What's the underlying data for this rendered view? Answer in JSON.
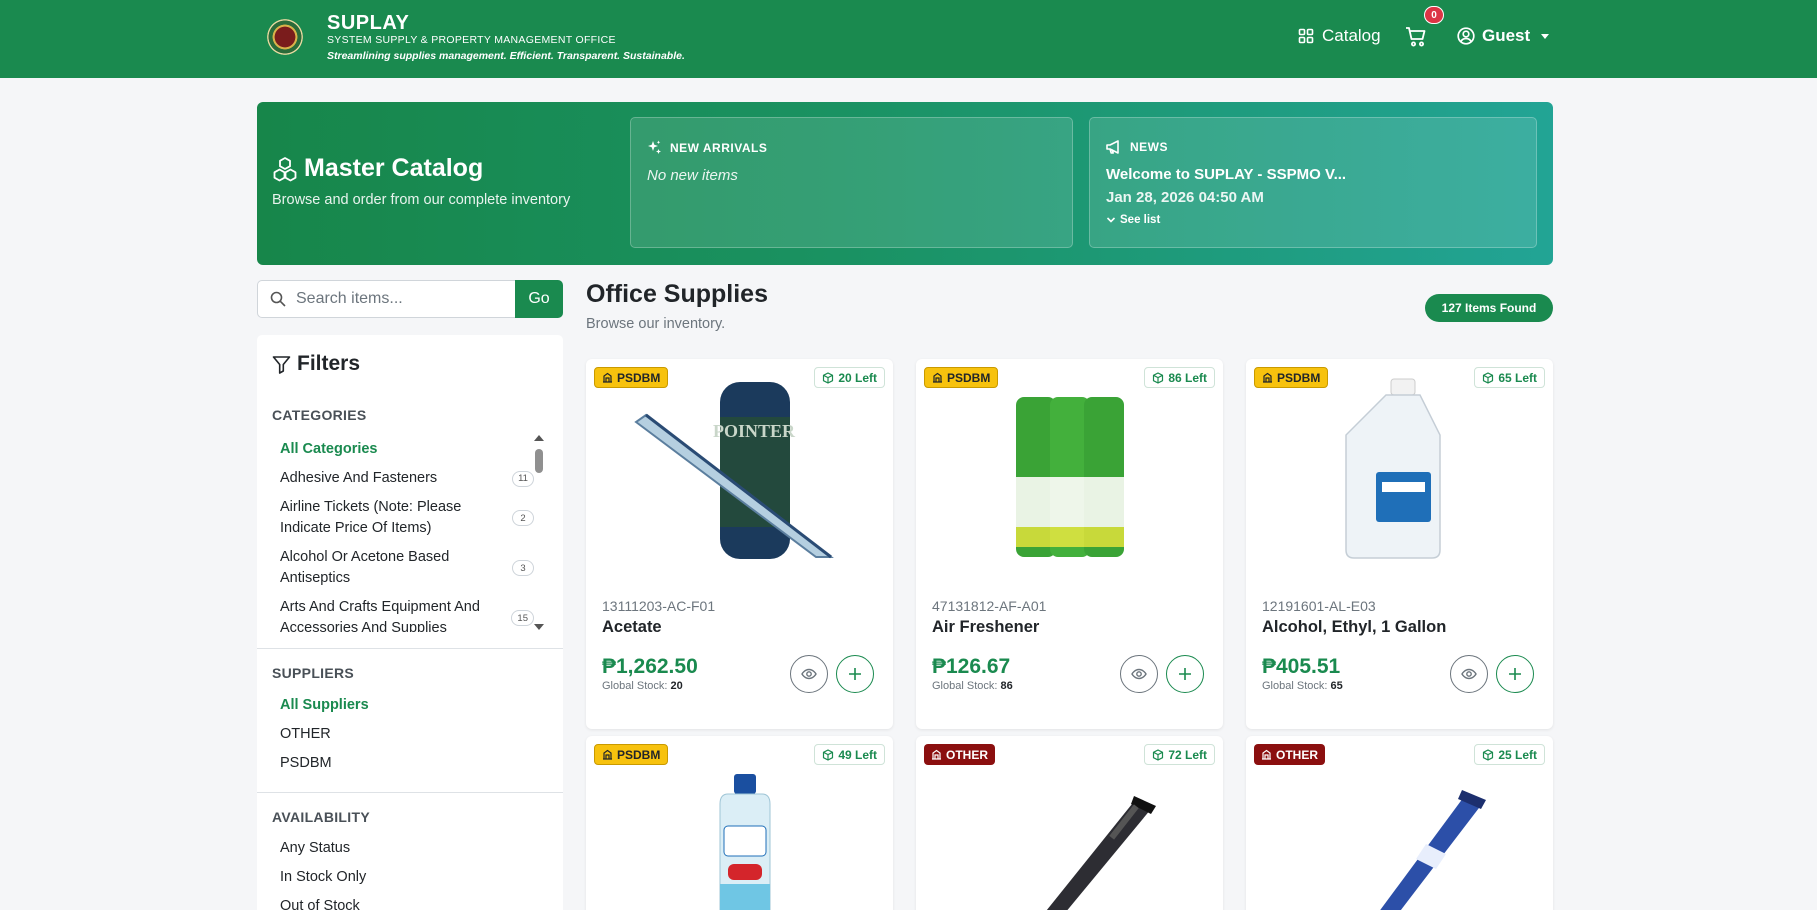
{
  "brand": {
    "title": "SUPLAY",
    "subtitle": "SYSTEM SUPPLY & PROPERTY MANAGEMENT OFFICE",
    "tagline": "Streamlining supplies management. Efficient. Transparent. Sustainable."
  },
  "nav": {
    "catalog_label": "Catalog",
    "cart_count": "0",
    "user_label": "Guest"
  },
  "hero": {
    "title": "Master Catalog",
    "subtitle": "Browse and order from our complete inventory",
    "arrivals_heading": "NEW ARRIVALS",
    "arrivals_empty": "No new items",
    "news_heading": "NEWS",
    "news_title": "Welcome to SUPLAY - SSPMO V...",
    "news_date": "Jan 28, 2026 04:50 AM",
    "news_see": "See list"
  },
  "search": {
    "placeholder": "Search items...",
    "go_label": "Go"
  },
  "filters": {
    "title": "Filters",
    "categories_heading": "CATEGORIES",
    "categories": [
      {
        "label": "All Categories",
        "count": ""
      },
      {
        "label": "Adhesive And Fasteners",
        "count": "11"
      },
      {
        "label": "Airline Tickets (Note: Please Indicate Price Of Items)",
        "count": "2"
      },
      {
        "label": "Alcohol Or Acetone Based Antiseptics",
        "count": "3"
      },
      {
        "label": "Arts And Crafts Equipment And Accessories And Supplies",
        "count": "15"
      }
    ],
    "suppliers_heading": "SUPPLIERS",
    "suppliers": [
      "All Suppliers",
      "OTHER",
      "PSDBM"
    ],
    "availability_heading": "AVAILABILITY",
    "availability": [
      "Any Status",
      "In Stock Only",
      "Out of Stock"
    ]
  },
  "main": {
    "title": "Office Supplies",
    "subtitle": "Browse our inventory.",
    "found_label": "127 Items Found"
  },
  "products": [
    {
      "supplier": "PSDBM",
      "left": "20 Left",
      "code": "13111203-AC-F01",
      "name": "Acetate",
      "price": "₱1,262.50",
      "stock_label": "Global Stock:",
      "stock": "20"
    },
    {
      "supplier": "PSDBM",
      "left": "86 Left",
      "code": "47131812-AF-A01",
      "name": "Air Freshener",
      "price": "₱126.67",
      "stock_label": "Global Stock:",
      "stock": "86"
    },
    {
      "supplier": "PSDBM",
      "left": "65 Left",
      "code": "12191601-AL-E03",
      "name": "Alcohol, Ethyl, 1 Gallon",
      "price": "₱405.51",
      "stock_label": "Global Stock:",
      "stock": "65"
    },
    {
      "supplier": "PSDBM",
      "left": "49 Left"
    },
    {
      "supplier": "OTHER",
      "left": "72 Left"
    },
    {
      "supplier": "OTHER",
      "left": "25 Left"
    }
  ],
  "colors": {
    "primary": "#1a8a4f",
    "psdbm_badge": "#f7c20e",
    "other_badge": "#8b0f0f",
    "cart_badge": "#dc3545"
  },
  "product_images": {
    "acetate_label": "POINTER"
  }
}
